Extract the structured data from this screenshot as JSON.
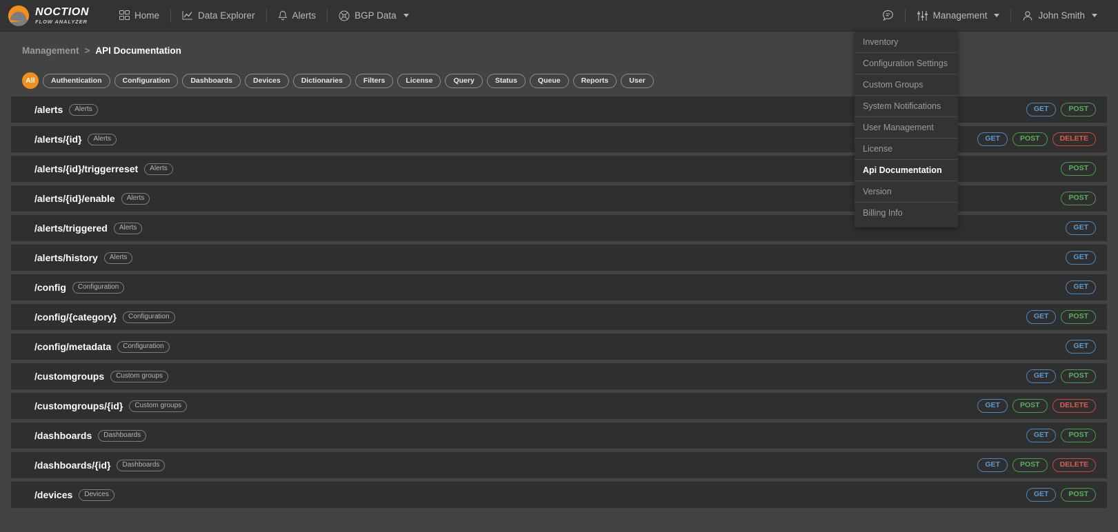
{
  "brand": {
    "name": "NOCTION",
    "tagline": "FLOW ANALYZER",
    "accent": "#f3901d"
  },
  "topnav": {
    "items": [
      {
        "label": "Home",
        "icon": "grid-icon",
        "has_caret": false
      },
      {
        "label": "Data Explorer",
        "icon": "chart-line-icon",
        "has_caret": false
      },
      {
        "label": "Alerts",
        "icon": "bell-icon",
        "has_caret": false
      },
      {
        "label": "BGP Data",
        "icon": "bgp-node-icon",
        "has_caret": true
      }
    ],
    "right": {
      "messages_icon": "speech-bubble-icon",
      "management_label": "Management",
      "management_icon": "sliders-icon",
      "user_label": "John Smith",
      "user_icon": "user-icon"
    }
  },
  "management_dropdown": {
    "items": [
      {
        "label": "Inventory",
        "current": false
      },
      {
        "label": "Configuration Settings",
        "current": false
      },
      {
        "label": "Custom Groups",
        "current": false
      },
      {
        "label": "System Notifications",
        "current": false
      },
      {
        "label": "User Management",
        "current": false
      },
      {
        "label": "License",
        "current": false
      },
      {
        "label": "Api Documentation",
        "current": true
      },
      {
        "label": "Version",
        "current": false
      },
      {
        "label": "Billing Info",
        "current": false
      }
    ]
  },
  "breadcrumb": {
    "parent": "Management",
    "separator": ">",
    "current": "API Documentation"
  },
  "filters": {
    "chips": [
      {
        "label": "All",
        "active": true
      },
      {
        "label": "Authentication",
        "active": false
      },
      {
        "label": "Configuration",
        "active": false
      },
      {
        "label": "Dashboards",
        "active": false
      },
      {
        "label": "Devices",
        "active": false
      },
      {
        "label": "Dictionaries",
        "active": false
      },
      {
        "label": "Filters",
        "active": false
      },
      {
        "label": "License",
        "active": false
      },
      {
        "label": "Query",
        "active": false
      },
      {
        "label": "Status",
        "active": false
      },
      {
        "label": "Queue",
        "active": false
      },
      {
        "label": "Reports",
        "active": false
      },
      {
        "label": "User",
        "active": false
      }
    ]
  },
  "method_colors": {
    "GET": "#5b9bd5",
    "POST": "#56b45a",
    "DELETE": "#e05a52"
  },
  "endpoints": [
    {
      "path": "/alerts",
      "tag": "Alerts",
      "methods": [
        "GET",
        "POST"
      ]
    },
    {
      "path": "/alerts/{id}",
      "tag": "Alerts",
      "methods": [
        "GET",
        "POST",
        "DELETE"
      ]
    },
    {
      "path": "/alerts/{id}/triggerreset",
      "tag": "Alerts",
      "methods": [
        "POST"
      ]
    },
    {
      "path": "/alerts/{id}/enable",
      "tag": "Alerts",
      "methods": [
        "POST"
      ]
    },
    {
      "path": "/alerts/triggered",
      "tag": "Alerts",
      "methods": [
        "GET"
      ]
    },
    {
      "path": "/alerts/history",
      "tag": "Alerts",
      "methods": [
        "GET"
      ]
    },
    {
      "path": "/config",
      "tag": "Configuration",
      "methods": [
        "GET"
      ]
    },
    {
      "path": "/config/{category}",
      "tag": "Configuration",
      "methods": [
        "GET",
        "POST"
      ]
    },
    {
      "path": "/config/metadata",
      "tag": "Configuration",
      "methods": [
        "GET"
      ]
    },
    {
      "path": "/customgroups",
      "tag": "Custom groups",
      "methods": [
        "GET",
        "POST"
      ]
    },
    {
      "path": "/customgroups/{id}",
      "tag": "Custom groups",
      "methods": [
        "GET",
        "POST",
        "DELETE"
      ]
    },
    {
      "path": "/dashboards",
      "tag": "Dashboards",
      "methods": [
        "GET",
        "POST"
      ]
    },
    {
      "path": "/dashboards/{id}",
      "tag": "Dashboards",
      "methods": [
        "GET",
        "POST",
        "DELETE"
      ]
    },
    {
      "path": "/devices",
      "tag": "Devices",
      "methods": [
        "GET",
        "POST"
      ]
    }
  ]
}
